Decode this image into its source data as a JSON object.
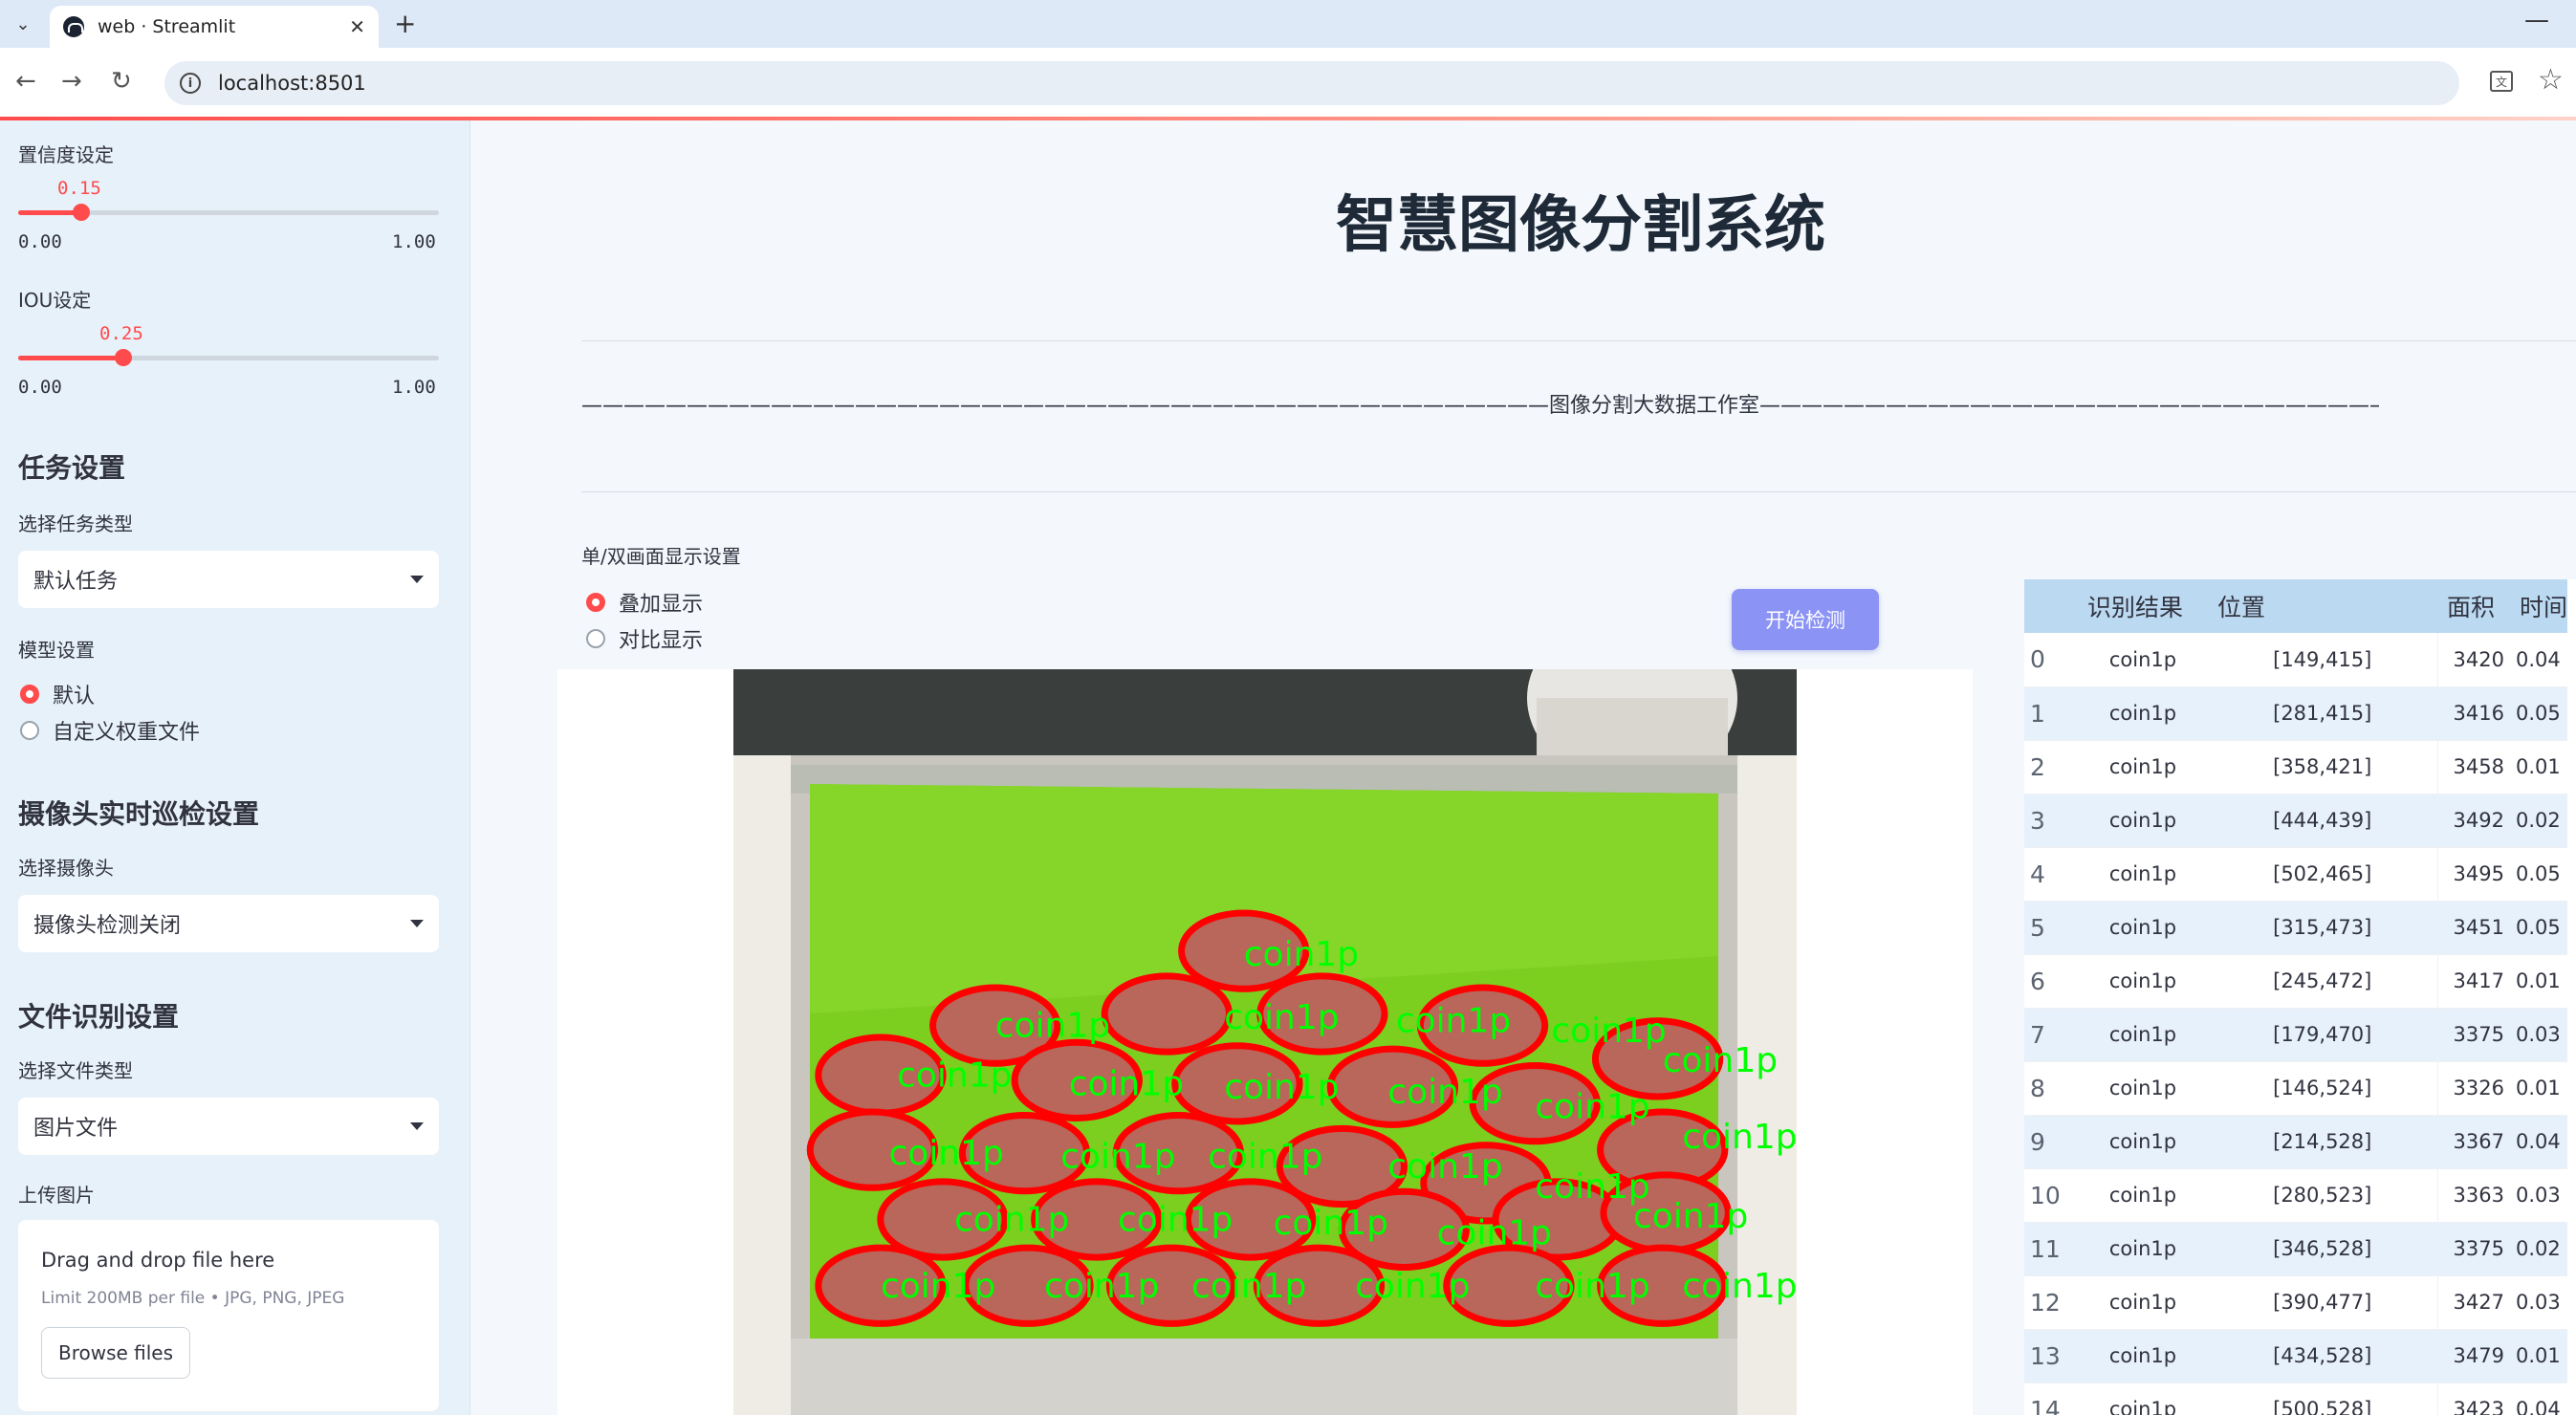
{
  "browser": {
    "tab_title": "web · Streamlit",
    "tab_close": "✕",
    "new_tab": "+",
    "minimize": "—",
    "url": "localhost:8501"
  },
  "sidebar": {
    "confidence_label": "置信度设定",
    "confidence": {
      "value": "0.15",
      "min": "0.00",
      "max": "1.00",
      "fraction": 0.15
    },
    "iou_label": "IOU设定",
    "iou": {
      "value": "0.25",
      "min": "0.00",
      "max": "1.00",
      "fraction": 0.25
    },
    "task_heading": "任务设置",
    "task_type_label": "选择任务类型",
    "task_type_value": "默认任务",
    "model_label": "模型设置",
    "model_options": [
      "默认",
      "自定义权重文件"
    ],
    "model_selected": 0,
    "camera_heading": "摄像头实时巡检设置",
    "camera_label": "选择摄像头",
    "camera_value": "摄像头检测关闭",
    "file_heading": "文件识别设置",
    "file_type_label": "选择文件类型",
    "file_type_value": "图片文件",
    "upload_label": "上传图片",
    "dropzone_title": "Drag and drop file here",
    "dropzone_limit": "Limit 200MB per file • JPG, PNG, JPEG",
    "browse_button": "Browse files"
  },
  "main": {
    "title": "智慧图像分割系统",
    "studio_line": "——————————————————————————————————————————————图像分割大数据工作室——————————————————————————————————————————————————",
    "display_label": "单/双画面显示设置",
    "display_options": [
      "叠加显示",
      "对比显示"
    ],
    "display_selected": 0,
    "start_button": "开始检测",
    "detection_label": "coin1p"
  },
  "results_table": {
    "columns": [
      "",
      "识别结果",
      "位置",
      "面积",
      "时间"
    ],
    "rows": [
      [
        "0",
        "coin1p",
        "[149,415]",
        "3420",
        "0.04"
      ],
      [
        "1",
        "coin1p",
        "[281,415]",
        "3416",
        "0.05"
      ],
      [
        "2",
        "coin1p",
        "[358,421]",
        "3458",
        "0.01"
      ],
      [
        "3",
        "coin1p",
        "[444,439]",
        "3492",
        "0.02"
      ],
      [
        "4",
        "coin1p",
        "[502,465]",
        "3495",
        "0.05"
      ],
      [
        "5",
        "coin1p",
        "[315,473]",
        "3451",
        "0.05"
      ],
      [
        "6",
        "coin1p",
        "[245,472]",
        "3417",
        "0.01"
      ],
      [
        "7",
        "coin1p",
        "[179,470]",
        "3375",
        "0.03"
      ],
      [
        "8",
        "coin1p",
        "[146,524]",
        "3326",
        "0.01"
      ],
      [
        "9",
        "coin1p",
        "[214,528]",
        "3367",
        "0.04"
      ],
      [
        "10",
        "coin1p",
        "[280,523]",
        "3363",
        "0.03"
      ],
      [
        "11",
        "coin1p",
        "[346,528]",
        "3375",
        "0.02"
      ],
      [
        "12",
        "coin1p",
        "[390,477]",
        "3427",
        "0.03"
      ],
      [
        "13",
        "coin1p",
        "[434,528]",
        "3479",
        "0.01"
      ],
      [
        "14",
        "coin1p",
        "[500,528]",
        "3423",
        "0.04"
      ]
    ]
  },
  "colors": {
    "accent": "#ff4b4b",
    "button": "#8b93f5",
    "table_header": "#bcd9f2",
    "mask_outline": "#ff0000",
    "label_text": "#00ff00",
    "background_green": "#7ed321"
  }
}
